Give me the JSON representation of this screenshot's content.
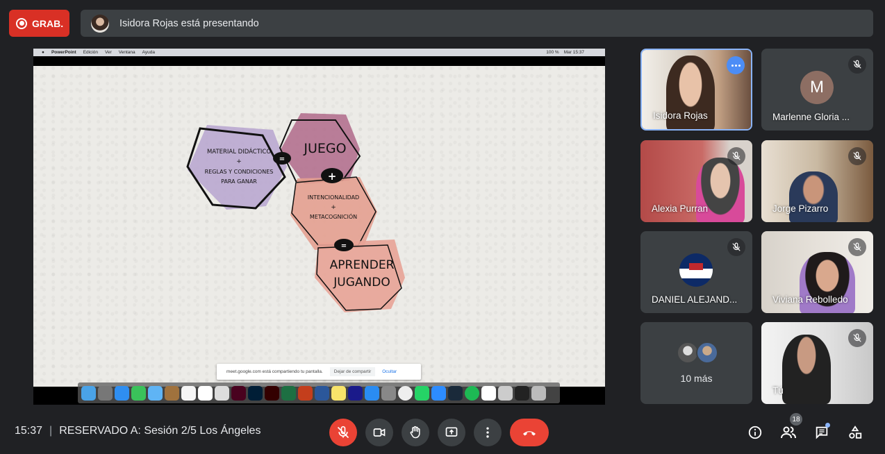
{
  "top": {
    "record_label": "GRAB.",
    "presenter_text": "Isidora Rojas está presentando"
  },
  "shared_screen": {
    "mac_menu": [
      "PowerPoint",
      "Edición",
      "Ver",
      "Ventana",
      "Ayuda"
    ],
    "mac_status": [
      "100 %",
      "Mar 15:37"
    ],
    "slide": {
      "left_shape_lines": [
        "MATERIAL DIDÁCTICO",
        "+",
        "REGLAS Y CONDICIONES",
        "PARA GANAR"
      ],
      "equals_1": "=",
      "top_shape": "JUEGO",
      "plus": "+",
      "middle_shape_lines": [
        "INTENCIONALIDAD",
        "+",
        "METACOGNICIÓN"
      ],
      "equals_2": "=",
      "bottom_shape_lines": [
        "APRENDER",
        "JUGANDO"
      ]
    },
    "share_notice": {
      "text": "meet.google.com está compartiendo tu pantalla.",
      "stop_label": "Dejar de compartir",
      "hide_label": "Ocultar"
    }
  },
  "participants": [
    {
      "name": "Isidora Rojas",
      "active": true
    },
    {
      "name": "Marlenne Gloria ...",
      "initial": "M"
    },
    {
      "name": "Alexia Purran"
    },
    {
      "name": "Jorge Pizarro"
    },
    {
      "name": "DANIEL ALEJAND..."
    },
    {
      "name": "Viviana Rebolledo"
    },
    {
      "name": "10 más"
    },
    {
      "name": "Tú"
    }
  ],
  "bottom": {
    "time": "15:37",
    "separator": "|",
    "meeting_title": "RESERVADO A: Sesión 2/5 Los Ángeles",
    "participant_count": "18"
  },
  "colors": {
    "background": "#202124",
    "tile": "#3c4043",
    "record": "#d93025",
    "end_call": "#ea4335",
    "active_border": "#8ab4f8",
    "more_button": "#4c8df6"
  }
}
